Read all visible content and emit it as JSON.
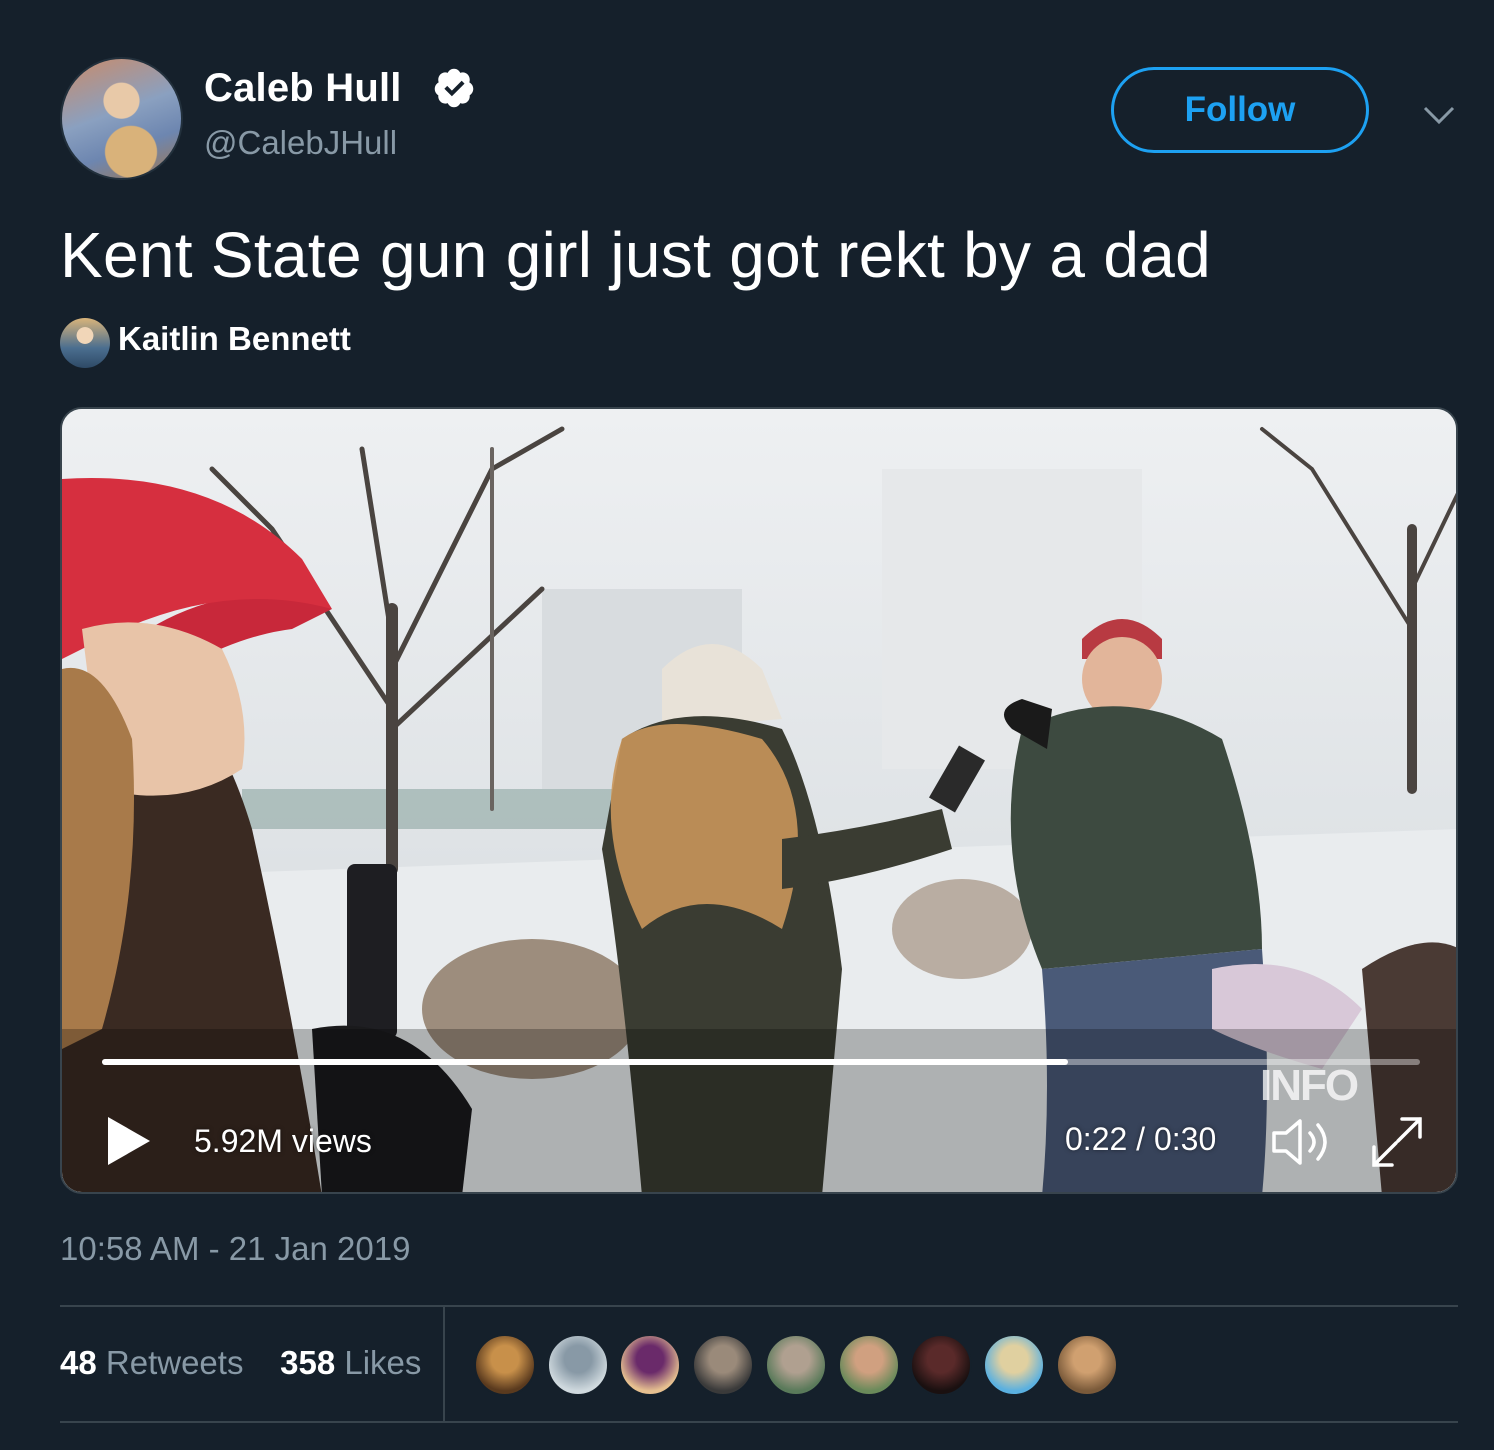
{
  "author": {
    "name": "Caleb Hull",
    "handle": "@CalebJHull",
    "verified": true,
    "avatar_icon": "avatar-photo"
  },
  "follow_button": {
    "label": "Follow",
    "color": "#1da1f2"
  },
  "menu_icon": "chevron-down-icon",
  "tweet": {
    "text": "Kent State gun girl just got rekt by a dad",
    "attribution": "Kaitlin Bennett"
  },
  "video": {
    "views": "5.92M views",
    "time": "0:22 / 0:30",
    "progress": 0.733,
    "watermark": "INFO"
  },
  "timestamp": "10:58 AM - 21 Jan 2019",
  "stats": {
    "retweets_count": "48",
    "retweets_label": "Retweets",
    "likes_count": "358",
    "likes_label": "Likes"
  },
  "likers": [
    {
      "name": "liker-dog",
      "colors": [
        "#5a3a1e",
        "#c8904a"
      ]
    },
    {
      "name": "liker-default",
      "colors": [
        "#cfd9de",
        "#8899a6"
      ]
    },
    {
      "name": "liker-woman-blonde",
      "colors": [
        "#e6c090",
        "#6a2a6a"
      ]
    },
    {
      "name": "liker-rider",
      "colors": [
        "#3a3a3a",
        "#9a8a7a"
      ]
    },
    {
      "name": "liker-woman-gray",
      "colors": [
        "#5a7a5a",
        "#b0a090"
      ]
    },
    {
      "name": "liker-woman-outdoor",
      "colors": [
        "#6a8a5a",
        "#d0a080"
      ]
    },
    {
      "name": "liker-dark",
      "colors": [
        "#1a1010",
        "#5a2a2a"
      ]
    },
    {
      "name": "liker-cartoon",
      "colors": [
        "#5ab0e0",
        "#e0d0a0"
      ]
    },
    {
      "name": "liker-couple",
      "colors": [
        "#7a5a3a",
        "#d0a070"
      ]
    }
  ],
  "theme": {
    "background": "#15202b",
    "secondary_text": "#8899a6",
    "divider": "#38444d"
  }
}
